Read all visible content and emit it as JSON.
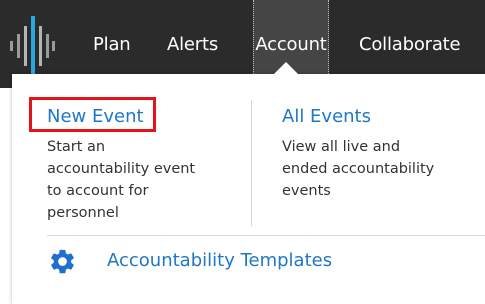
{
  "nav": {
    "items": [
      {
        "label": "Plan"
      },
      {
        "label": "Alerts"
      },
      {
        "label": "Account",
        "active": true
      },
      {
        "label": "Collaborate"
      }
    ]
  },
  "dropdown": {
    "new_event": {
      "label": "New Event",
      "description": "Start an\naccountability event\nto account for\npersonnel"
    },
    "all_events": {
      "label": "All Events",
      "description": "View all live and\nended accountability\nevents"
    },
    "templates": {
      "label": "Accountability Templates",
      "icon": "gear-icon"
    }
  },
  "colors": {
    "navbar_bg": "#2b2b2b",
    "link": "#1f77c7",
    "highlight_border": "#e2141b",
    "logo_accent": "#29a8e0"
  }
}
